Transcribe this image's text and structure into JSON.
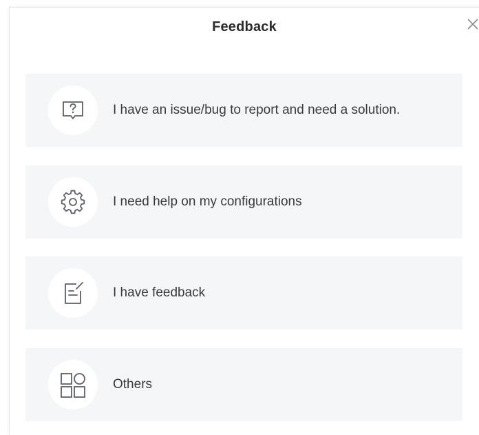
{
  "dialog": {
    "title": "Feedback",
    "close_icon": "close-icon"
  },
  "options": [
    {
      "icon": "question-icon",
      "label": "I have an issue/bug to report and need a solution."
    },
    {
      "icon": "gear-icon",
      "label": "I need help on my configurations"
    },
    {
      "icon": "edit-note-icon",
      "label": "I have feedback"
    },
    {
      "icon": "grid-icon",
      "label": "Others"
    }
  ],
  "colors": {
    "option_background": "#f5f6f8",
    "icon_stroke": "#5c5f66",
    "text": "#3a3a3a"
  }
}
